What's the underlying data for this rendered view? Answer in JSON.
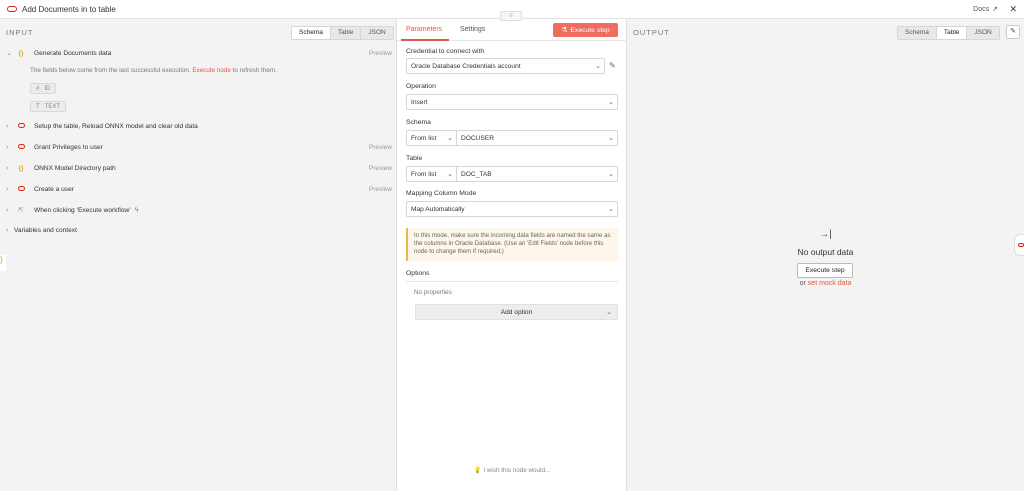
{
  "header": {
    "title": "Add Documents in to table",
    "docs_label": "Docs",
    "close_glyph": "✕"
  },
  "input": {
    "label": "INPUT",
    "view_tabs": [
      "Schema",
      "Table",
      "JSON"
    ],
    "nodes": [
      {
        "label": "Generate Documents data",
        "icon": "braces-icon",
        "preview": "Preview",
        "expanded": true
      },
      {
        "label": "Setup the table, Reload ONNX model and clear old data",
        "icon": "oracle-icon",
        "preview": ""
      },
      {
        "label": "Grant Privileges to user",
        "icon": "oracle-icon",
        "preview": "Preview"
      },
      {
        "label": "ONNX Model Directory path",
        "icon": "braces-icon",
        "preview": "Preview"
      },
      {
        "label": "Create a user",
        "icon": "oracle-icon",
        "preview": "Preview"
      },
      {
        "label": "When clicking ‘Execute workflow’",
        "icon": "cursor-icon",
        "preview": ""
      }
    ],
    "hint_prefix": "The fields below come from the last successful execution.",
    "hint_link": "Execute node",
    "hint_suffix": "to refresh them.",
    "fields": [
      {
        "type": "#",
        "name": "ID"
      },
      {
        "type": "T",
        "name": "TEXT"
      }
    ],
    "variables_label": "Variables and context"
  },
  "params": {
    "tabs": [
      "Parameters",
      "Settings"
    ],
    "execute_label": "Execute step",
    "credential_label": "Credential to connect with",
    "credential_value": "Oracle Database Credentials account",
    "operation_label": "Operation",
    "operation_value": "Insert",
    "schema_label": "Schema",
    "schema_mode": "From list",
    "schema_value": "DOCUSER",
    "table_label": "Table",
    "table_mode": "From list",
    "table_value": "DOC_TAB",
    "mapping_label": "Mapping Column Mode",
    "mapping_value": "Map Automatically",
    "notice": "In this mode, make sure the incoming data fields are named the same as the columns in Oracle Database. (Use an 'Edit Fields' node before this node to change them if required.)",
    "options_label": "Options",
    "no_properties": "No properties",
    "add_option_label": "Add option",
    "wish_text": "I wish this node would..."
  },
  "output": {
    "label": "OUTPUT",
    "view_tabs": [
      "Schema",
      "Table",
      "JSON"
    ],
    "empty_title": "No output data",
    "execute_label": "Execute step",
    "mock_prefix": "or",
    "mock_link": "set mock data"
  },
  "colors": {
    "accent": "#e0584a",
    "oracle_red": "#d9251c",
    "braces": "#e8a317"
  }
}
